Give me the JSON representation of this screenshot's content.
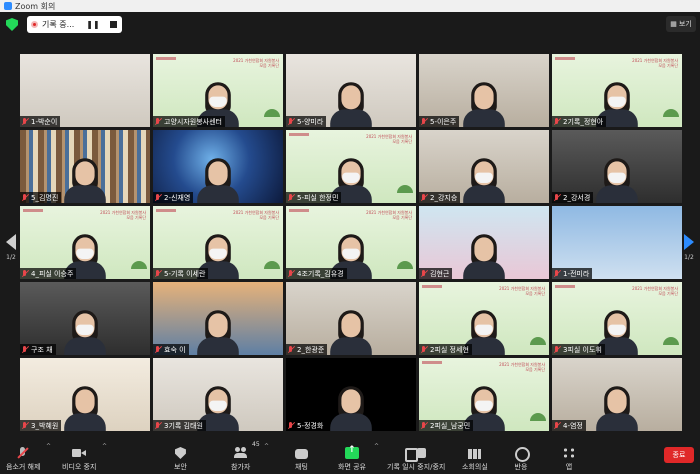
{
  "window": {
    "title": "Zoom 회의"
  },
  "recording": {
    "label": "기록 중..."
  },
  "view_button": {
    "label": "보기"
  },
  "banner_text": "2021 가천연합회 자원봉사 모음 기록단",
  "pager": {
    "left": "1/2",
    "right": "1/2"
  },
  "participants": [
    {
      "name": "1-박순이",
      "bg": "wall",
      "person": false
    },
    {
      "name": "고양시자원봉사센터",
      "bg": "green",
      "person": true,
      "mask": true
    },
    {
      "name": "5-양미라",
      "bg": "wall",
      "person": true,
      "mask": false
    },
    {
      "name": "5-이은주",
      "bg": "room",
      "person": true,
      "mask": false
    },
    {
      "name": "2기록_정현아",
      "bg": "green",
      "person": true,
      "mask": true
    },
    {
      "name": "5_김명진",
      "bg": "shelf",
      "person": true,
      "mask": false
    },
    {
      "name": "2-신재영",
      "bg": "space",
      "person": true,
      "mask": false
    },
    {
      "name": "5-피실 한정민",
      "bg": "green",
      "person": true,
      "mask": true
    },
    {
      "name": "2_강지승",
      "bg": "room",
      "person": true,
      "mask": true
    },
    {
      "name": "2_강서경",
      "bg": "dark",
      "person": true,
      "mask": true
    },
    {
      "name": "4_피실 이승주",
      "bg": "green",
      "person": true,
      "mask": true
    },
    {
      "name": "5-기록 이세란",
      "bg": "green",
      "person": true,
      "mask": true
    },
    {
      "name": "4조기록_김유경",
      "bg": "green",
      "person": true,
      "mask": true
    },
    {
      "name": "김현근",
      "bg": "kids",
      "person": true,
      "mask": false
    },
    {
      "name": "1-전미라",
      "bg": "sky",
      "person": false
    },
    {
      "name": "구조 채",
      "bg": "dark",
      "person": true,
      "mask": true
    },
    {
      "name": "효숙 이",
      "bg": "sunset",
      "person": true,
      "mask": false
    },
    {
      "name": "2_한광준",
      "bg": "room",
      "person": true,
      "mask": false
    },
    {
      "name": "2피실 정세현",
      "bg": "green",
      "person": true,
      "mask": true
    },
    {
      "name": "3피실 이도휘",
      "bg": "green",
      "person": true,
      "mask": true
    },
    {
      "name": "3_박혜원",
      "bg": "cream",
      "person": true,
      "mask": false
    },
    {
      "name": "3기록 김태원",
      "bg": "wall",
      "person": true,
      "mask": true
    },
    {
      "name": "5-정경화",
      "bg": "black",
      "person": true,
      "mask": false
    },
    {
      "name": "2피실_남궁민",
      "bg": "green",
      "person": true,
      "mask": true
    },
    {
      "name": "4-염정",
      "bg": "room",
      "person": true,
      "mask": false
    }
  ],
  "toolbar": {
    "mute": "음소거 해제",
    "video": "비디오 중지",
    "security": "보안",
    "participants": "참가자",
    "participants_count": "45",
    "chat": "채팅",
    "share": "화면 공유",
    "record": "기록 일시 중지/중지",
    "rooms": "소회의실",
    "reactions": "반응",
    "apps": "앱",
    "end": "종료"
  }
}
